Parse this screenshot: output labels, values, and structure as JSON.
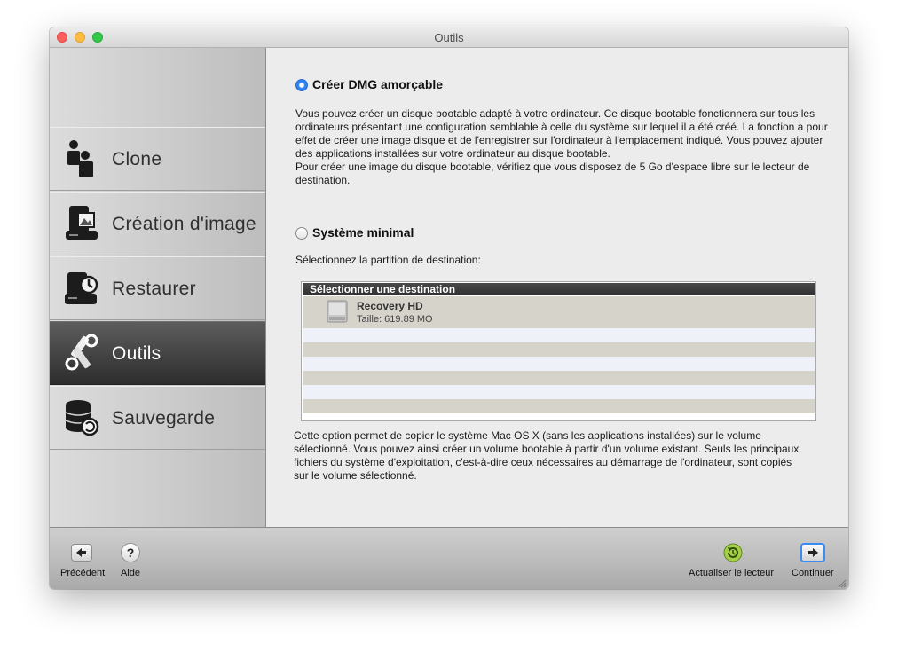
{
  "window": {
    "title": "Outils"
  },
  "sidebar": {
    "items": [
      {
        "label": "Clone",
        "icon": "clone-icon"
      },
      {
        "label": "Création d'image",
        "icon": "disk-image-icon"
      },
      {
        "label": "Restaurer",
        "icon": "restore-icon"
      },
      {
        "label": "Outils",
        "icon": "tools-icon",
        "active": true
      },
      {
        "label": "Sauvegarde",
        "icon": "backup-database-icon"
      }
    ]
  },
  "options": {
    "dmg": {
      "label": "Créer DMG amorçable",
      "selected": true,
      "description": [
        "Vous pouvez créer un disque bootable adapté à votre ordinateur. Ce disque bootable fonctionnera sur tous les ordinateurs présentant une configuration semblable à celle du système sur lequel il a été créé. La fonction a pour effet de créer une image disque et de l'enregistrer sur l'ordinateur à l'emplacement indiqué. Vous pouvez ajouter des applications installées sur votre ordinateur au disque bootable.",
        "Pour créer une image du disque bootable, vérifiez que vous disposez de 5 Go d'espace libre sur le lecteur de destination."
      ]
    },
    "minimal": {
      "label": "Système minimal",
      "selected": false,
      "partition_prompt": "Sélectionnez la partition de destination:",
      "list_header": "Sélectionner une destination",
      "destinations": [
        {
          "name": "Recovery HD",
          "size": "Taille: 619.89 MO"
        }
      ],
      "description": "Cette option permet de copier le système Mac OS X (sans les applications installées) sur le volume sélectionné. Vous pouvez ainsi créer un volume bootable à partir d'un volume existant. Seuls les principaux fichiers du système d'exploitation, c'est-à-dire ceux nécessaires au démarrage de l'ordinateur, sont copiés sur le volume sélectionné."
    }
  },
  "toolbar": {
    "previous_label": "Précédent",
    "help_label": "Aide",
    "refresh_label": "Actualiser le lecteur",
    "continue_label": "Continuer"
  },
  "colors": {
    "active_nav": "#3a3a3a",
    "radio_selected": "#2f7ff0",
    "list_row_alt": "#d6d3cb",
    "list_row": "#eef1f8"
  }
}
